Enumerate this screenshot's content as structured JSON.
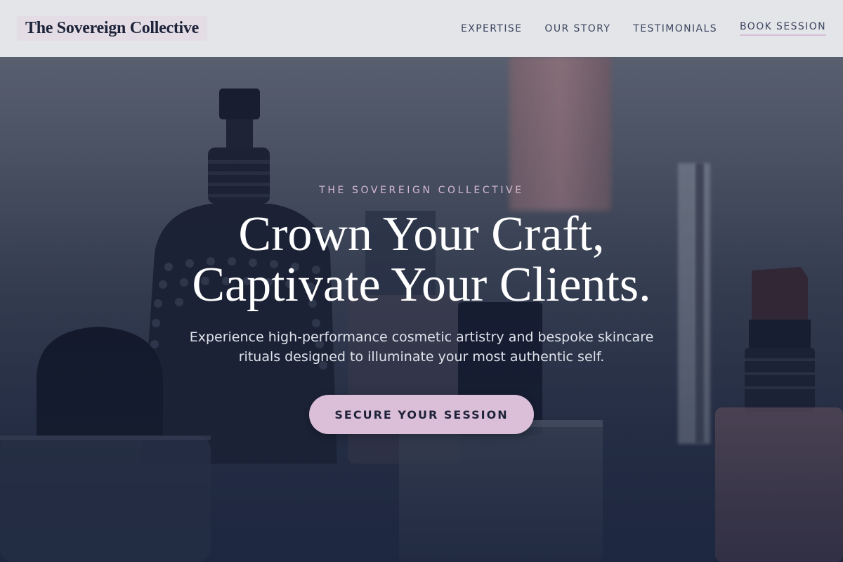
{
  "navbar": {
    "brand": "The Sovereign Collective",
    "links": [
      {
        "label": "EXPERTISE"
      },
      {
        "label": "OUR STORY"
      },
      {
        "label": "TESTIMONIALS"
      },
      {
        "label": "BOOK SESSION"
      }
    ]
  },
  "hero": {
    "eyebrow": "THE SOVEREIGN COLLECTIVE",
    "headline_line1": "Crown Your Craft,",
    "headline_line2": "Captivate Your Clients.",
    "subtext": "Experience high-performance cosmetic artistry and bespoke skincare rituals designed to illuminate your most authentic self.",
    "cta_label": "SECURE YOUR SESSION",
    "background": "cosmetic-bottles-photo"
  },
  "colors": {
    "accent": "#dbbfd9",
    "navy": "#1e2238",
    "eyebrow": "#d4b9d2"
  }
}
